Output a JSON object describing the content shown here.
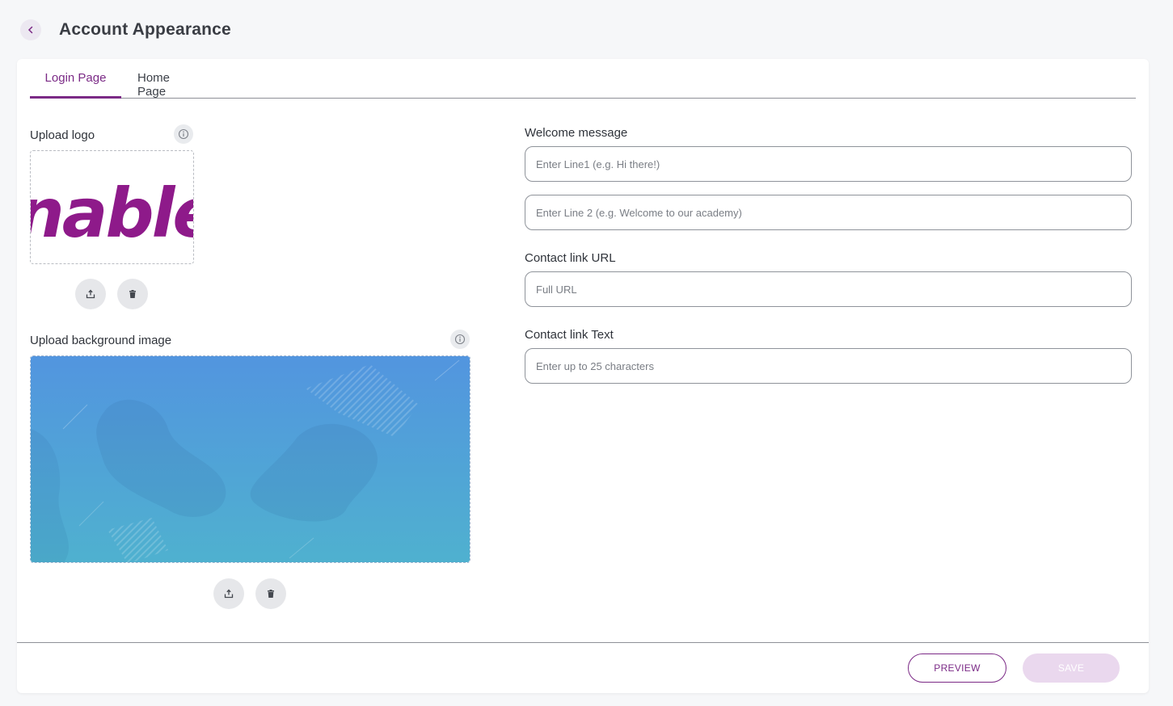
{
  "header": {
    "title": "Account Appearance"
  },
  "tabs": [
    {
      "label": "Login Page",
      "active": true
    },
    {
      "label": "Home Page",
      "active": false
    }
  ],
  "left": {
    "logo_label": "Upload logo",
    "logo_text": "nable",
    "background_label": "Upload background image"
  },
  "right": {
    "welcome_label": "Welcome message",
    "line1_placeholder": "Enter Line1 (e.g. Hi there!)",
    "line2_placeholder": "Enter Line 2 (e.g. Welcome to our academy)",
    "contact_url_label": "Contact link URL",
    "contact_url_placeholder": "Full URL",
    "contact_text_label": "Contact link Text",
    "contact_text_placeholder": "Enter up to 25 characters"
  },
  "footer": {
    "preview_label": "PREVIEW",
    "save_label": "SAVE"
  },
  "colors": {
    "accent": "#7b2a86",
    "save_disabled": "#ead8ee",
    "background_gradient_top": "#5295df",
    "background_gradient_bottom": "#4fb1cf"
  },
  "icons": {
    "back": "chevron-left-icon",
    "info": "info-icon",
    "upload": "upload-icon",
    "delete": "trash-icon"
  }
}
